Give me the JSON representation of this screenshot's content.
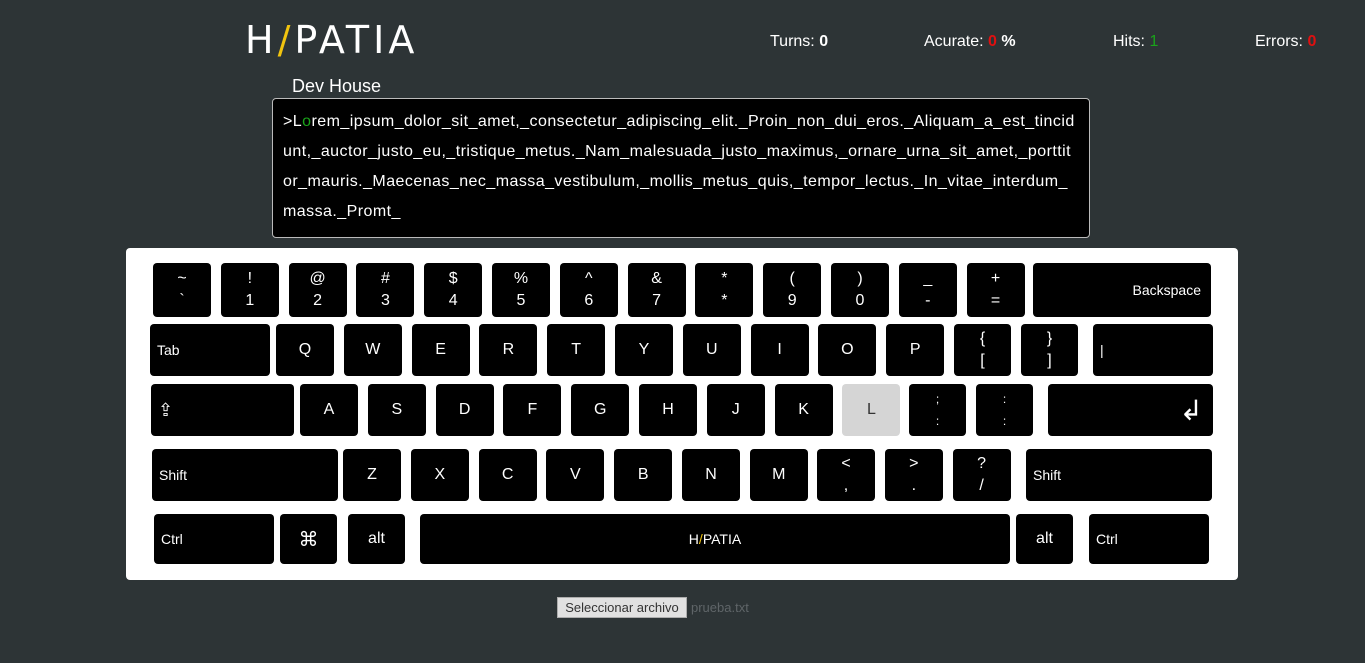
{
  "logo": {
    "prefix": "H",
    "slash": "/",
    "suffix": "PATIA",
    "subtitle": "Dev House"
  },
  "stats": {
    "turns_label": "Turns:",
    "turns_value": "0",
    "accuracy_label": "Acurate:",
    "accuracy_value": "0",
    "accuracy_unit": "%",
    "hits_label": "Hits:",
    "hits_value": "1",
    "errors_label": "Errors:",
    "errors_value": "0"
  },
  "text": {
    "done": ">L",
    "current": "o",
    "rest": "rem_ipsum_dolor_sit_amet,_consectetur_adipiscing_elit._Proin_non_dui_eros._Aliquam_a_est_tincidunt,_auctor_justo_eu,_tristique_metus._Nam_malesuada_justo_maximus,_ornare_urna_sit_amet,_porttitor_mauris._Maecenas_nec_massa_vestibulum,_mollis_metus_quis,_tempor_lectus._In_vitae_interdum_massa._Promt_"
  },
  "keyboard": {
    "row1": [
      [
        "~",
        "`"
      ],
      [
        "!",
        "1"
      ],
      [
        "@",
        "2"
      ],
      [
        "#",
        "3"
      ],
      [
        "$",
        "4"
      ],
      [
        "%",
        "5"
      ],
      [
        "^",
        "6"
      ],
      [
        "&",
        "7"
      ],
      [
        "*",
        "*"
      ],
      [
        "(",
        "9"
      ],
      [
        ")",
        "0"
      ],
      [
        "_",
        "-"
      ],
      [
        "+",
        "="
      ]
    ],
    "backspace": "Backspace",
    "tab": "Tab",
    "row2": [
      "Q",
      "W",
      "E",
      "R",
      "T",
      "Y",
      "U",
      "I",
      "O",
      "P"
    ],
    "row2_brackets": [
      [
        "{",
        "["
      ],
      [
        "}",
        "]"
      ]
    ],
    "pipe": "|",
    "caps_icon": "⇪",
    "row3": [
      "A",
      "S",
      "D",
      "F",
      "G",
      "H",
      "J",
      "K",
      "L"
    ],
    "row3_punct": [
      [
        ";",
        ":"
      ],
      [
        ":",
        ":"
      ]
    ],
    "enter_icon": "↲",
    "shift": "Shift",
    "row4": [
      "Z",
      "X",
      "C",
      "V",
      "B",
      "N",
      "M"
    ],
    "row4_punct": [
      [
        "<",
        ","
      ],
      [
        ">",
        "."
      ],
      [
        "?",
        "/"
      ]
    ],
    "ctrl": "Ctrl",
    "cmd_icon": "⌘",
    "alt": "alt",
    "space_prefix": "H",
    "space_slash": "/",
    "space_suffix": "PATIA",
    "active_key": "L"
  },
  "file": {
    "button": "Seleccionar archivo",
    "name": "prueba.txt"
  }
}
